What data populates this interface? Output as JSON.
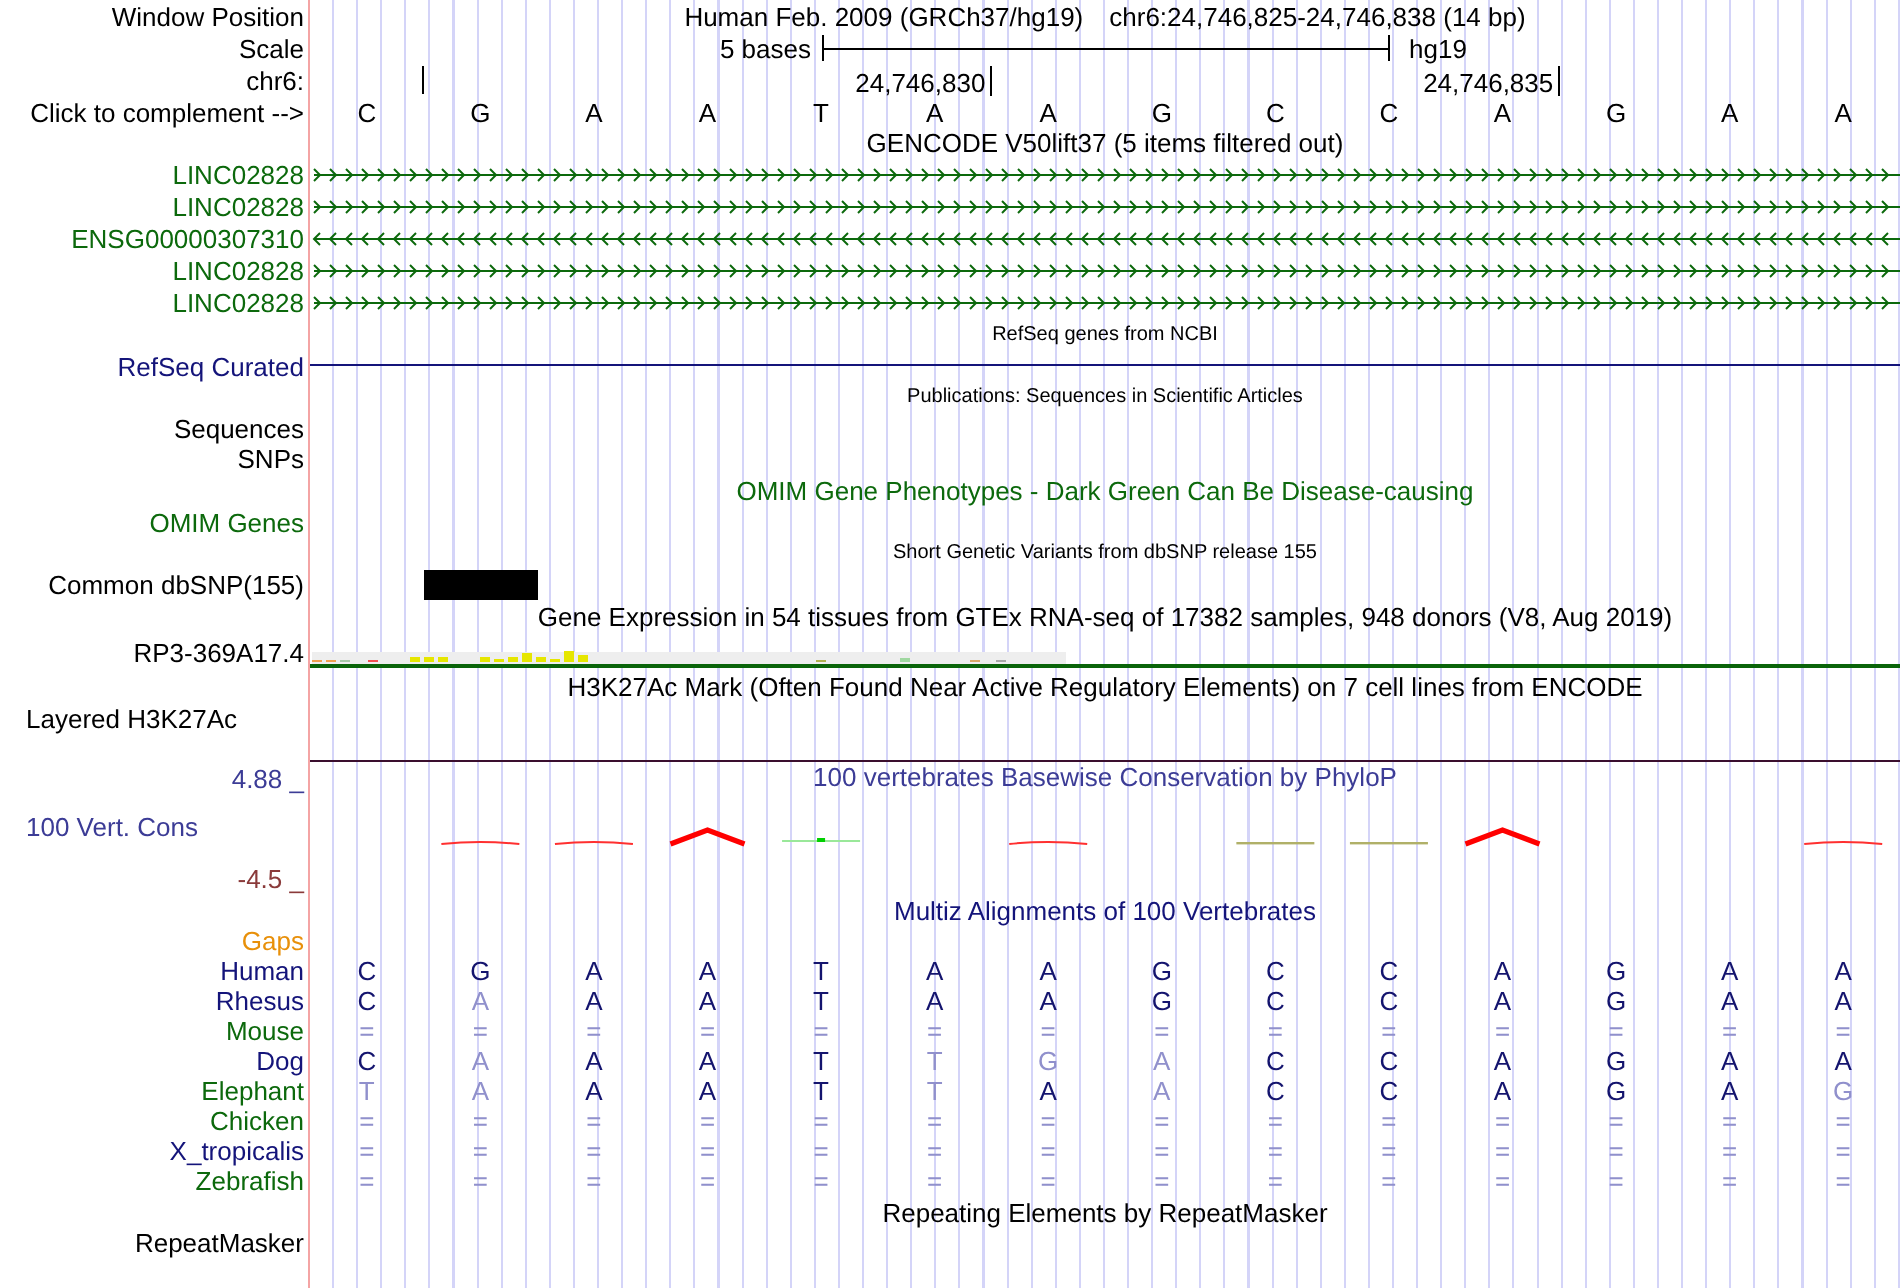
{
  "position": {
    "label": "Window Position",
    "assembly": "Human Feb. 2009 (GRCh37/hg19)",
    "range": "chr6:24,746,825-24,746,838 (14 bp)"
  },
  "scale": {
    "label": "Scale",
    "length": "5 bases",
    "assembly": "hg19"
  },
  "ruler": {
    "label": "chr6:",
    "ticks": [
      "24,746,830",
      "24,746,835"
    ]
  },
  "sequence": {
    "label": "Click to complement -->",
    "bases": [
      "C",
      "G",
      "A",
      "A",
      "T",
      "A",
      "A",
      "G",
      "C",
      "C",
      "A",
      "G",
      "A",
      "A"
    ]
  },
  "tracks": [
    {
      "kind": "gencode",
      "title": "GENCODE V50lift37 (5 items filtered out)",
      "color": "#0c690c",
      "items": [
        {
          "name": "LINC02828",
          "reverse": false
        },
        {
          "name": "LINC02828",
          "reverse": false
        },
        {
          "name": "ENSG00000307310",
          "reverse": true
        },
        {
          "name": "LINC02828",
          "reverse": false
        },
        {
          "name": "LINC02828",
          "reverse": false
        }
      ]
    },
    {
      "kind": "refseq",
      "title": "RefSeq genes from NCBI",
      "label": "RefSeq Curated",
      "color": "#14147a"
    },
    {
      "kind": "publications",
      "title": "Publications: Sequences in Scientific Articles",
      "labels": [
        "Sequences",
        "SNPs"
      ],
      "color": "#000000"
    },
    {
      "kind": "omim",
      "title": "OMIM Gene Phenotypes - Dark Green Can Be Disease-causing",
      "label": "OMIM Genes",
      "color": "#0c690c"
    },
    {
      "kind": "dbsnp",
      "title": "Short Genetic Variants from dbSNP release 155",
      "label": "Common dbSNP(155)",
      "color": "#000000"
    },
    {
      "kind": "gtex",
      "title": "Gene Expression in 54 tissues from GTEx RNA-seq of 17382 samples, 948 donors (V8, Aug 2019)",
      "label": "RP3-369A17.4",
      "color": "#000000"
    },
    {
      "kind": "h3k27ac",
      "title": "H3K27Ac Mark (Often Found Near Active Regulatory Elements) on 7 cell lines from ENCODE",
      "label": "Layered H3K27Ac",
      "color": "#000000"
    },
    {
      "kind": "phylop",
      "title": "100 vertebrates Basewise Conservation by PhyloP",
      "label": "100 Vert. Cons",
      "max": "4.88 _",
      "min": "-4.5 _",
      "color": "#3c3c96"
    },
    {
      "kind": "multiz",
      "title": "Multiz Alignments of 100 Vertebrates",
      "gaps_label": "Gaps",
      "color": "#14147a",
      "species": [
        {
          "name": "Human",
          "color": "#14147a",
          "bases": [
            {
              "base": "C",
              "match": true
            },
            {
              "base": "G",
              "match": true
            },
            {
              "base": "A",
              "match": true
            },
            {
              "base": "A",
              "match": true
            },
            {
              "base": "T",
              "match": true
            },
            {
              "base": "A",
              "match": true
            },
            {
              "base": "A",
              "match": true
            },
            {
              "base": "G",
              "match": true
            },
            {
              "base": "C",
              "match": true
            },
            {
              "base": "C",
              "match": true
            },
            {
              "base": "A",
              "match": true
            },
            {
              "base": "G",
              "match": true
            },
            {
              "base": "A",
              "match": true
            },
            {
              "base": "A",
              "match": true
            }
          ]
        },
        {
          "name": "Rhesus",
          "color": "#14147a",
          "bases": [
            {
              "base": "C",
              "match": true
            },
            {
              "base": "A",
              "match": false
            },
            {
              "base": "A",
              "match": true
            },
            {
              "base": "A",
              "match": true
            },
            {
              "base": "T",
              "match": true
            },
            {
              "base": "A",
              "match": true
            },
            {
              "base": "A",
              "match": true
            },
            {
              "base": "G",
              "match": true
            },
            {
              "base": "C",
              "match": true
            },
            {
              "base": "C",
              "match": true
            },
            {
              "base": "A",
              "match": true
            },
            {
              "base": "G",
              "match": true
            },
            {
              "base": "A",
              "match": true
            },
            {
              "base": "A",
              "match": true
            }
          ]
        },
        {
          "name": "Mouse",
          "color": "#0c690c",
          "bases": [
            {
              "base": "=",
              "match": false
            },
            {
              "base": "=",
              "match": false
            },
            {
              "base": "=",
              "match": false
            },
            {
              "base": "=",
              "match": false
            },
            {
              "base": "=",
              "match": false
            },
            {
              "base": "=",
              "match": false
            },
            {
              "base": "=",
              "match": false
            },
            {
              "base": "=",
              "match": false
            },
            {
              "base": "=",
              "match": false
            },
            {
              "base": "=",
              "match": false
            },
            {
              "base": "=",
              "match": false
            },
            {
              "base": "=",
              "match": false
            },
            {
              "base": "=",
              "match": false
            },
            {
              "base": "=",
              "match": false
            }
          ]
        },
        {
          "name": "Dog",
          "color": "#14147a",
          "bases": [
            {
              "base": "C",
              "match": true
            },
            {
              "base": "A",
              "match": false
            },
            {
              "base": "A",
              "match": true
            },
            {
              "base": "A",
              "match": true
            },
            {
              "base": "T",
              "match": true
            },
            {
              "base": "T",
              "match": false
            },
            {
              "base": "G",
              "match": false
            },
            {
              "base": "A",
              "match": false
            },
            {
              "base": "C",
              "match": true
            },
            {
              "base": "C",
              "match": true
            },
            {
              "base": "A",
              "match": true
            },
            {
              "base": "G",
              "match": true
            },
            {
              "base": "A",
              "match": true
            },
            {
              "base": "A",
              "match": true
            }
          ]
        },
        {
          "name": "Elephant",
          "color": "#0c690c",
          "bases": [
            {
              "base": "T",
              "match": false
            },
            {
              "base": "A",
              "match": false
            },
            {
              "base": "A",
              "match": true
            },
            {
              "base": "A",
              "match": true
            },
            {
              "base": "T",
              "match": true
            },
            {
              "base": "T",
              "match": false
            },
            {
              "base": "A",
              "match": true
            },
            {
              "base": "A",
              "match": false
            },
            {
              "base": "C",
              "match": true
            },
            {
              "base": "C",
              "match": true
            },
            {
              "base": "A",
              "match": true
            },
            {
              "base": "G",
              "match": true
            },
            {
              "base": "A",
              "match": true
            },
            {
              "base": "G",
              "match": false
            }
          ]
        },
        {
          "name": "Chicken",
          "color": "#0c690c",
          "bases": [
            {
              "base": "=",
              "match": false
            },
            {
              "base": "=",
              "match": false
            },
            {
              "base": "=",
              "match": false
            },
            {
              "base": "=",
              "match": false
            },
            {
              "base": "=",
              "match": false
            },
            {
              "base": "=",
              "match": false
            },
            {
              "base": "=",
              "match": false
            },
            {
              "base": "=",
              "match": false
            },
            {
              "base": "=",
              "match": false
            },
            {
              "base": "=",
              "match": false
            },
            {
              "base": "=",
              "match": false
            },
            {
              "base": "=",
              "match": false
            },
            {
              "base": "=",
              "match": false
            },
            {
              "base": "=",
              "match": false
            }
          ]
        },
        {
          "name": "X_tropicalis",
          "color": "#14147a",
          "bases": [
            {
              "base": "=",
              "match": false
            },
            {
              "base": "=",
              "match": false
            },
            {
              "base": "=",
              "match": false
            },
            {
              "base": "=",
              "match": false
            },
            {
              "base": "=",
              "match": false
            },
            {
              "base": "=",
              "match": false
            },
            {
              "base": "=",
              "match": false
            },
            {
              "base": "=",
              "match": false
            },
            {
              "base": "=",
              "match": false
            },
            {
              "base": "=",
              "match": false
            },
            {
              "base": "=",
              "match": false
            },
            {
              "base": "=",
              "match": false
            },
            {
              "base": "=",
              "match": false
            },
            {
              "base": "=",
              "match": false
            }
          ]
        },
        {
          "name": "Zebrafish",
          "color": "#0c690c",
          "bases": [
            {
              "base": "=",
              "match": false
            },
            {
              "base": "=",
              "match": false
            },
            {
              "base": "=",
              "match": false
            },
            {
              "base": "=",
              "match": false
            },
            {
              "base": "=",
              "match": false
            },
            {
              "base": "=",
              "match": false
            },
            {
              "base": "=",
              "match": false
            },
            {
              "base": "=",
              "match": false
            },
            {
              "base": "=",
              "match": false
            },
            {
              "base": "=",
              "match": false
            },
            {
              "base": "=",
              "match": false
            },
            {
              "base": "=",
              "match": false
            },
            {
              "base": "=",
              "match": false
            },
            {
              "base": "=",
              "match": false
            }
          ]
        }
      ]
    },
    {
      "kind": "repeatmasker",
      "title": "Repeating Elements by RepeatMasker",
      "label": "RepeatMasker",
      "color": "#000000"
    }
  ]
}
